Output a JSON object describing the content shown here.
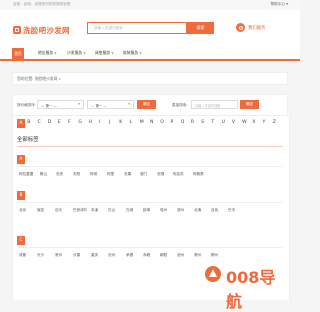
{
  "topbar": {
    "left_text": "全部 - 目标、未提供可供热搜的标签",
    "right_text": "帮助中心 ▾"
  },
  "header": {
    "logo_text": "洗脸吧沙发网",
    "search_placeholder": "请输入关键词搜索",
    "search_button": "搜索",
    "service_text": "我们服务"
  },
  "nav": {
    "home": "首页",
    "items": [
      {
        "label": "地址服务"
      },
      {
        "label": "沙发服务"
      },
      {
        "label": "床垫服务"
      },
      {
        "label": "软装服务"
      }
    ]
  },
  "breadcrumb": "您的位置: 洗脸吧沙发网 »",
  "filter": {
    "label1": "按价格排序:",
    "select1": "— 第一 —",
    "select2": "— 第一 —",
    "button1": "确定",
    "label2": "直接搜索:",
    "input_placeholder": "请输入关键字搜索",
    "button2": "确定"
  },
  "letters": [
    "A",
    "B",
    "C",
    "D",
    "E",
    "F",
    "G",
    "H",
    "I",
    "J",
    "K",
    "L",
    "M",
    "N",
    "O",
    "P",
    "Q",
    "R",
    "S",
    "T",
    "U",
    "V",
    "W",
    "X",
    "Y",
    "Z"
  ],
  "active_letter": "A",
  "section_title": "全部标签",
  "groups": [
    {
      "letter": "A",
      "tags": [
        "阿拉善盟",
        "鞍山",
        "安庆",
        "安阳",
        "阿坝",
        "阿里",
        "安康",
        "澳门",
        "安顺",
        "阿克苏",
        "阿勒泰"
      ]
    },
    {
      "letter": "B",
      "tags": [
        "北京",
        "保定",
        "包头",
        "巴彦淖尔",
        "本溪",
        "白山",
        "白城",
        "蚌埠",
        "亳州",
        "滨州",
        "北海",
        "百色",
        "巴中"
      ]
    },
    {
      "letter": "C",
      "tags": [
        "成都",
        "长沙",
        "常州",
        "长春",
        "重庆",
        "沧州",
        "承德",
        "赤峰",
        "朝阳",
        "池州",
        "滁州",
        "郴州"
      ]
    }
  ],
  "watermark": {
    "text": "008导航"
  }
}
